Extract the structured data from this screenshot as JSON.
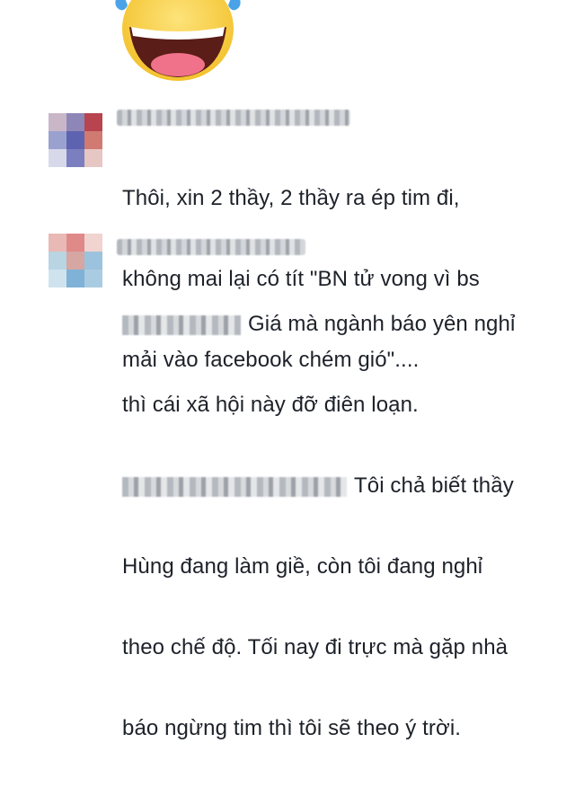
{
  "comments": [
    {
      "lines": [
        "Thôi, xin 2 thầy, 2 thầy ra ép tim đi,",
        "không mai lại có tít \"BN tử vong vì bs",
        "mải vào facebook chém gió\"...."
      ]
    },
    {
      "replies": [
        {
          "lines": [
            "Giá mà ngành báo yên nghỉ",
            "thì cái xã hội này đỡ điên loạn."
          ]
        },
        {
          "lines": [
            "Tôi chả biết thầy",
            "Hùng đang làm giề, còn tôi đang nghỉ",
            "theo chế độ. Tối nay đi trực mà gặp nhà",
            "báo ngừng tim thì tôi sẽ theo ý trời."
          ]
        }
      ]
    }
  ],
  "emoji_icon": "laughing-tears-emoji",
  "colors": {
    "text": "#1d2129",
    "emoji_yellow": "#f7d44a",
    "tear_blue": "#4aa3e8"
  }
}
